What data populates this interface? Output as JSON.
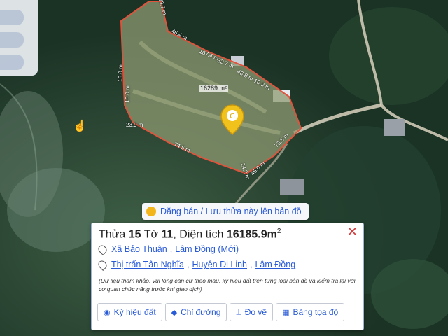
{
  "map": {
    "parcel_area_label": "16289 m²",
    "edge_labels": [
      "23.7 m",
      "46.4 m",
      "167.4 m",
      "32.7 m",
      "43.8 m",
      "10.9 m",
      "18.0 m",
      "16.0 m",
      "23.9 m",
      "74.5 m",
      "73.5 m",
      "45.0 m",
      "24.2 m"
    ],
    "colors": {
      "parcel_outline": "#e0533c",
      "road": "#d9d2c0",
      "pin": "#f2c21c"
    }
  },
  "post_bar": {
    "label": "Đăng bán / Lưu thửa này lên bản đồ"
  },
  "card": {
    "title_prefix": "Thửa ",
    "parcel_no": "15",
    "sheet_prefix": " Tờ ",
    "sheet_no": "11",
    "area_prefix": ", Diện tích ",
    "area_value": "16185.9m",
    "area_unit_sup": "2",
    "new_address": {
      "commune": "Xã Bảo Thuận",
      "sep": ", ",
      "province": "Lâm Đồng (Mới)"
    },
    "old_address": {
      "town": "Thị trấn Tân Nghĩa",
      "sep1": ", ",
      "district": "Huyện Di Linh",
      "sep2": ", ",
      "province": "Lâm Đồng"
    },
    "note": "(Dữ liệu tham khảo, vui lòng căn cứ theo màu, ký hiệu đất trên từng loại bản đồ và kiểm tra lại với cơ quan chức năng trước khi giao dịch)",
    "buttons": [
      {
        "label": "Ký hiệu đất",
        "icon": "palette-icon"
      },
      {
        "label": "Chỉ đường",
        "icon": "directions-icon"
      },
      {
        "label": "Đo vẽ",
        "icon": "measure-icon"
      },
      {
        "label": "Bảng tọa độ",
        "icon": "table-icon"
      }
    ],
    "close": "✕"
  }
}
